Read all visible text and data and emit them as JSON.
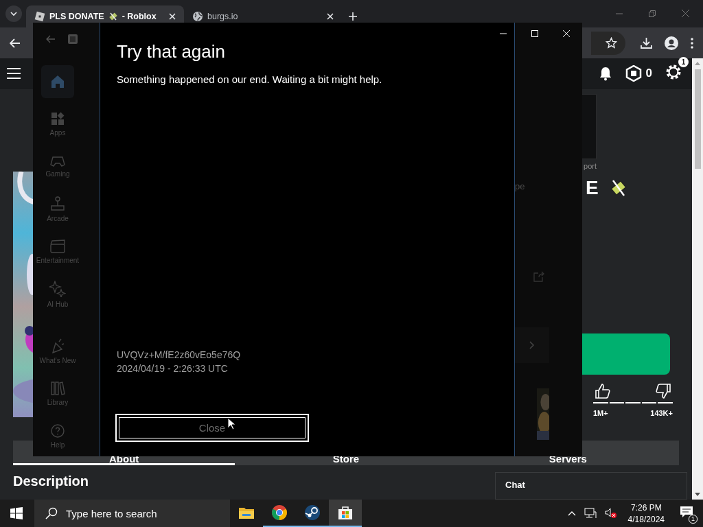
{
  "browser": {
    "tabs": [
      {
        "title": "PLS DONATE",
        "suffix": "- Roblox",
        "kind": "roblox",
        "selected": true
      },
      {
        "title": "burgs.io",
        "kind": "globe",
        "selected": false
      }
    ]
  },
  "page": {
    "robux": "0",
    "notification_badge": "1",
    "support_text": "port",
    "title_fragment": "E",
    "side_text": "pe",
    "likes": "1M+",
    "dislikes": "143K+",
    "tabs": [
      {
        "label": "About",
        "selected": true
      },
      {
        "label": "Store",
        "selected": false
      },
      {
        "label": "Servers",
        "selected": false
      }
    ],
    "description_heading": "Description",
    "chat_title": "Chat"
  },
  "store": {
    "nav": [
      {
        "kind": "home",
        "selected": true
      },
      {
        "kind": "apps",
        "label": "Apps",
        "selected": false
      },
      {
        "kind": "gaming",
        "label": "Gaming",
        "selected": false
      },
      {
        "kind": "arcade",
        "label": "Arcade",
        "selected": false
      },
      {
        "kind": "entertainment",
        "label": "Entertainment",
        "selected": false
      },
      {
        "kind": "ai",
        "label": "AI Hub",
        "selected": false
      },
      {
        "kind": "new",
        "label": "What's New",
        "selected": false
      },
      {
        "kind": "library",
        "label": "Library",
        "selected": false
      },
      {
        "kind": "help",
        "label": "Help",
        "selected": false
      }
    ]
  },
  "dialog": {
    "title": "Try that again",
    "message": "Something happened on our end. Waiting a bit might help.",
    "code": "UVQVz+M/fE2z60vEo5e76Q",
    "timestamp": "2024/04/19 - 2:26:33 UTC",
    "button": "Close"
  },
  "taskbar": {
    "search_placeholder": "Type here to search",
    "apps": [
      {
        "kind": "folder",
        "running": false,
        "selected": false
      },
      {
        "kind": "chrome",
        "running": true,
        "selected": false
      },
      {
        "kind": "steam",
        "running": true,
        "selected": false
      },
      {
        "kind": "store",
        "running": true,
        "selected": true
      }
    ],
    "time": "7:26 PM",
    "date": "4/18/2024",
    "notifications": "1"
  }
}
